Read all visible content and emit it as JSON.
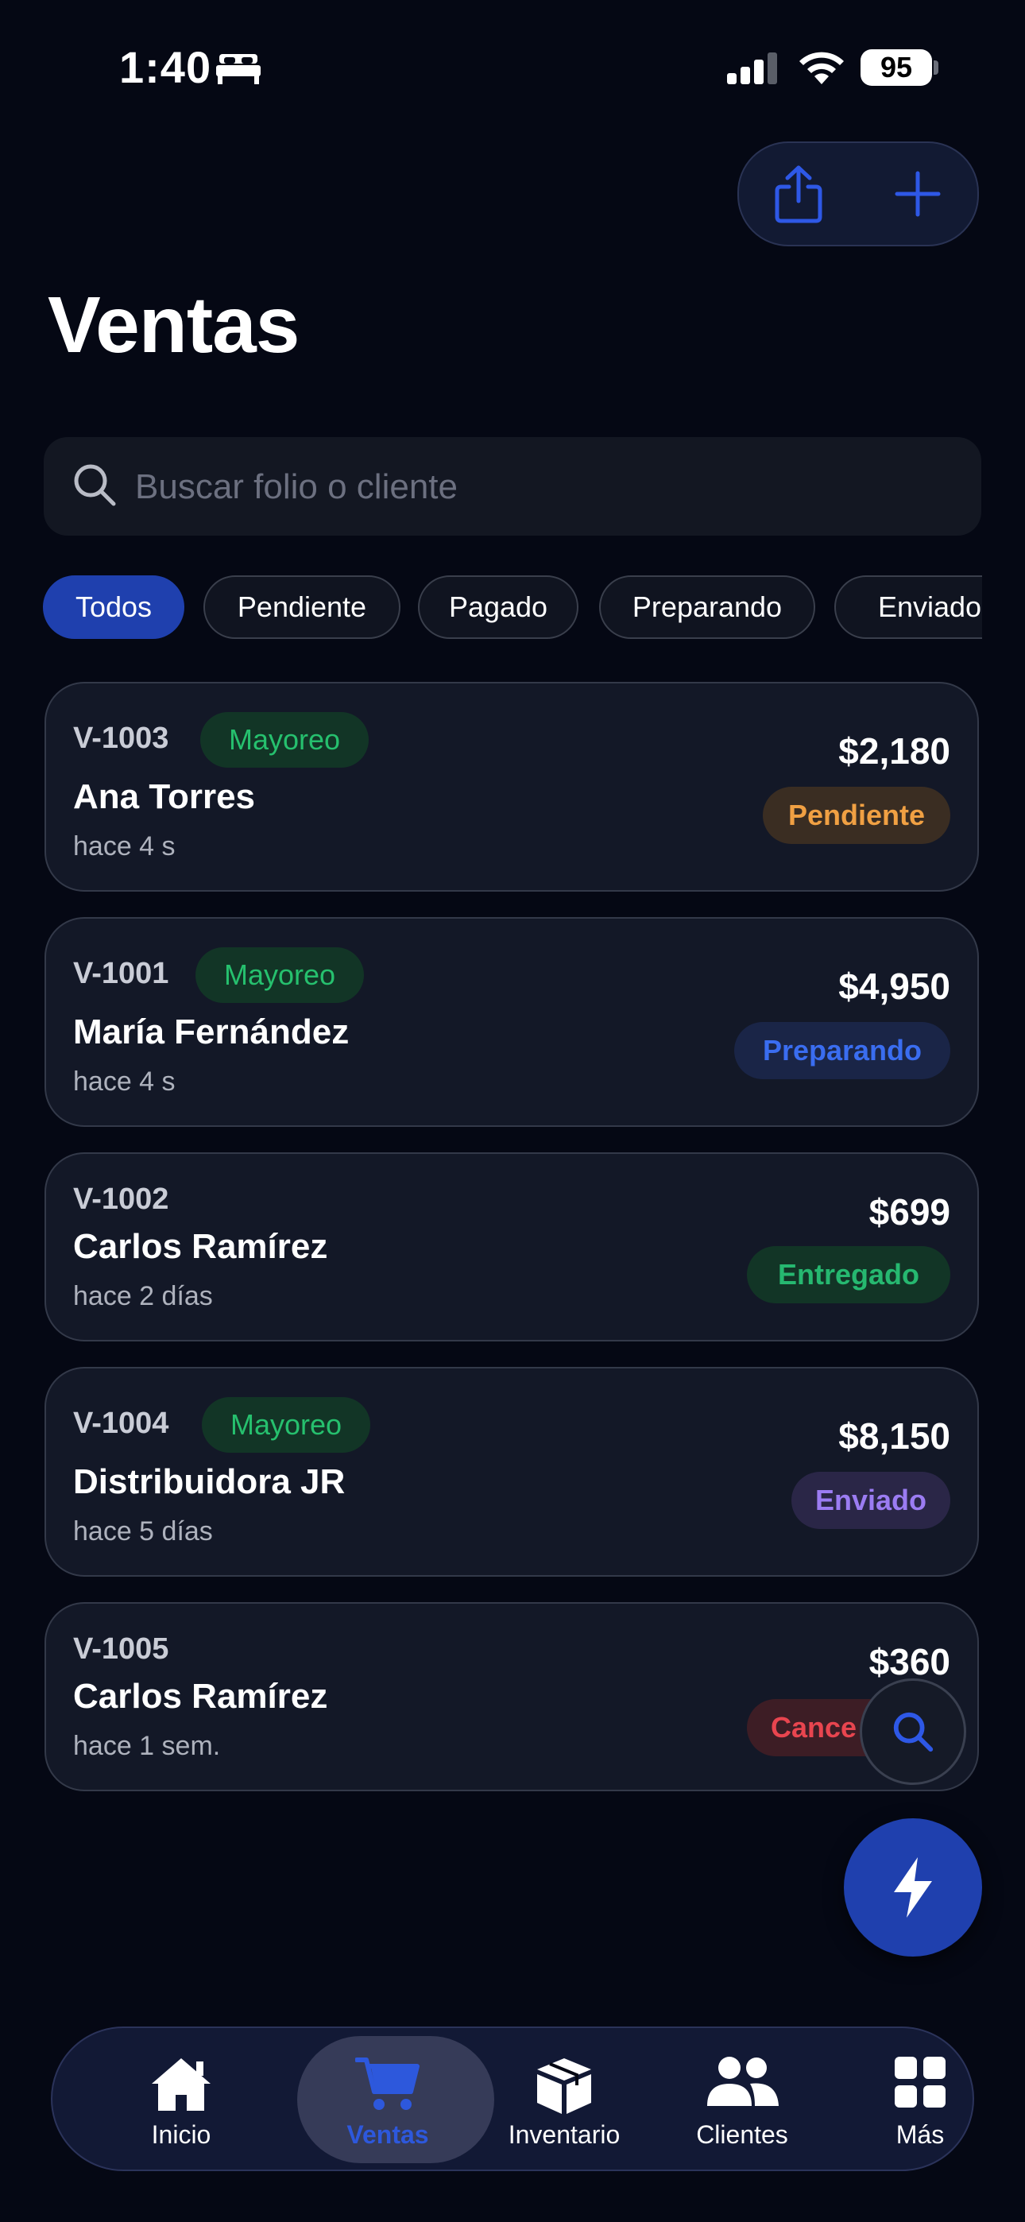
{
  "status_bar": {
    "time": "1:40",
    "battery": "95"
  },
  "header": {
    "title": "Ventas",
    "share_icon": "share-icon",
    "add_icon": "plus-icon"
  },
  "search": {
    "placeholder": "Buscar folio o cliente",
    "value": ""
  },
  "filters": [
    "Todos",
    "Pendiente",
    "Pagado",
    "Preparando",
    "Enviado"
  ],
  "active_filter": "Todos",
  "sales": [
    {
      "folio": "V-1003",
      "badge": "Mayoreo",
      "client": "Ana Torres",
      "time": "hace 4 s",
      "amount": "$2,180",
      "status": "Pendiente"
    },
    {
      "folio": "V-1001",
      "badge": "Mayoreo",
      "client": "María Fernández",
      "time": "hace 4 s",
      "amount": "$4,950",
      "status": "Preparando"
    },
    {
      "folio": "V-1002",
      "badge": "",
      "client": "Carlos Ramírez",
      "time": "hace 2 días",
      "amount": "$699",
      "status": "Entregado"
    },
    {
      "folio": "V-1004",
      "badge": "Mayoreo",
      "client": "Distribuidora JR",
      "time": "hace 5 días",
      "amount": "$8,150",
      "status": "Enviado"
    },
    {
      "folio": "V-1005",
      "badge": "",
      "client": "Carlos Ramírez",
      "time": "hace 1 sem.",
      "amount": "$360",
      "status": "Cance"
    }
  ],
  "status_colors": {
    "Pendiente": {
      "fg": "#f0a043",
      "bg": "#3a2d22"
    },
    "Preparando": {
      "fg": "#3a6df0",
      "bg": "#1a2547"
    },
    "Entregado": {
      "fg": "#26b870",
      "bg": "#123526"
    },
    "Enviado": {
      "fg": "#9b7cf2",
      "bg": "#2a2647"
    },
    "Cance": {
      "fg": "#e8454f",
      "bg": "#3d1d25"
    }
  },
  "colors": {
    "accent": "#1f40ae",
    "active_tab": "#2d58dc",
    "background": "#050814"
  },
  "fab": {
    "icon": "bolt-icon"
  },
  "floating_search": {
    "icon": "search-icon"
  },
  "tabs": [
    {
      "label": "Inicio",
      "icon": "home-icon"
    },
    {
      "label": "Ventas",
      "icon": "cart-icon"
    },
    {
      "label": "Inventario",
      "icon": "box-icon"
    },
    {
      "label": "Clientes",
      "icon": "users-icon"
    },
    {
      "label": "Más",
      "icon": "grid-icon"
    }
  ],
  "active_tab": "Ventas"
}
